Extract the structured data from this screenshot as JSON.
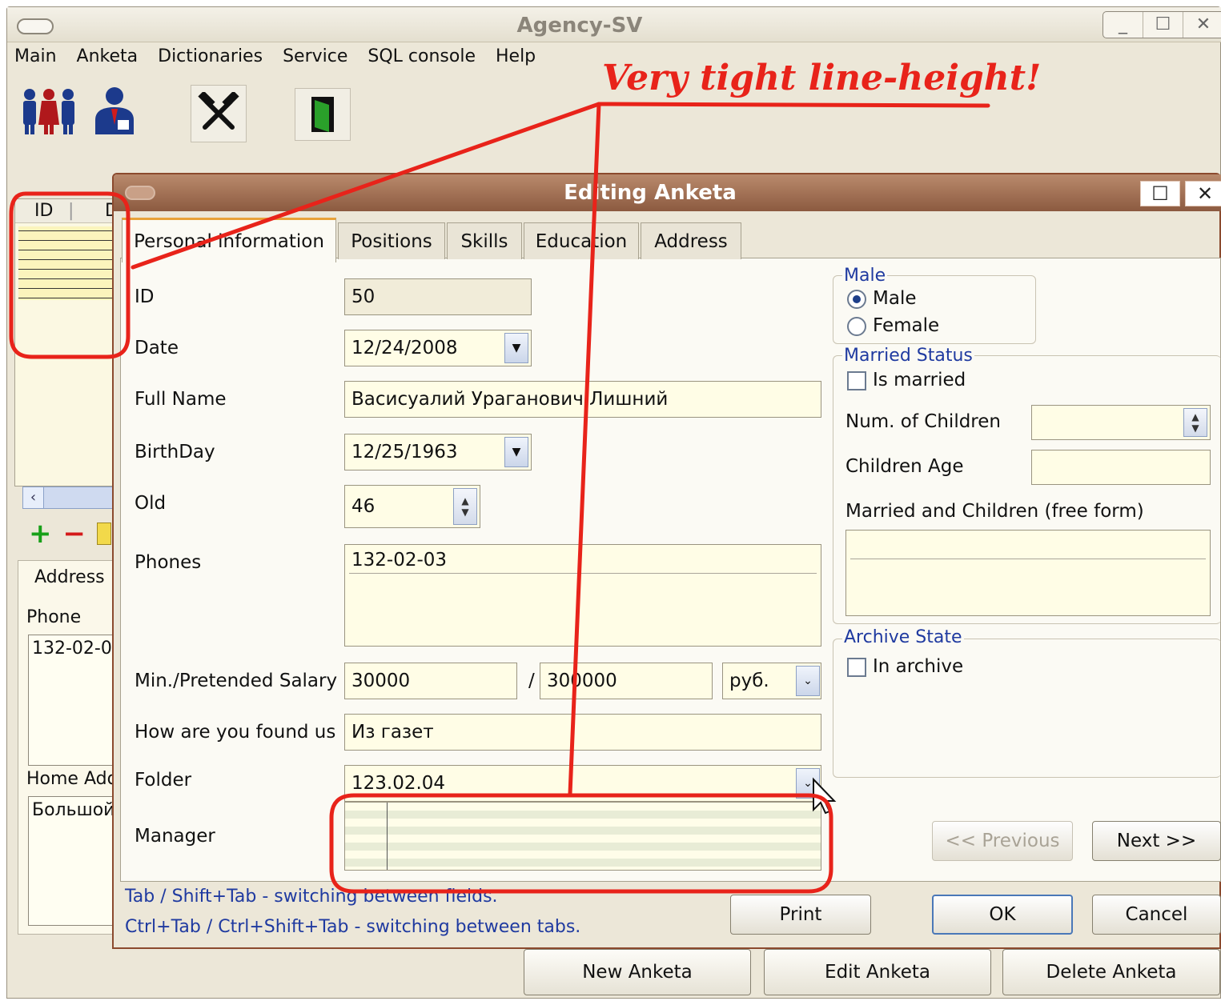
{
  "main_window": {
    "title": "Agency-SV",
    "menu": [
      "Main",
      "Anketa",
      "Dictionaries",
      "Service",
      "SQL console",
      "Help"
    ],
    "toolbar_icons": [
      "people-group-icon",
      "manager-person-icon",
      "hammer-tools-icon",
      "exit-door-icon"
    ]
  },
  "left_panel": {
    "column_id": "ID",
    "column_2": "D",
    "address_tab": "Address",
    "phone_label": "Phone",
    "phone_value": "132-02-0",
    "home_address_label": "Home Add",
    "home_address_value": "Большой"
  },
  "bottom_buttons": {
    "new": "New Anketa",
    "edit": "Edit Anketa",
    "delete": "Delete Anketa"
  },
  "dialog": {
    "title": "Editing Anketa",
    "tabs": [
      "Personal information",
      "Positions",
      "Skills",
      "Education",
      "Address"
    ],
    "fields": {
      "id_label": "ID",
      "id_value": "50",
      "date_label": "Date",
      "date_value": "12/24/2008",
      "fullname_label": "Full Name",
      "fullname_value": "Васисуалий Ураганович Лишний",
      "birthday_label": "BirthDay",
      "birthday_value": "12/25/1963",
      "old_label": "Old",
      "old_value": "46",
      "phones_label": "Phones",
      "phones_value": "132-02-03",
      "salary_label": "Min./Pretended Salary",
      "salary_min": "30000",
      "salary_sep": "/",
      "salary_max": "300000",
      "currency": "руб.",
      "found_label": "How are you found us",
      "found_value": "Из газет",
      "folder_label": "Folder",
      "folder_value": "123.02.04",
      "manager_label": "Manager"
    },
    "sex_group": {
      "title": "Male",
      "male": "Male",
      "female": "Female",
      "selected": "Male"
    },
    "married_group": {
      "title": "Married Status",
      "is_married": "Is married",
      "children_num": "Num. of Children",
      "children_age": "Children Age",
      "free_form": "Married and Children (free form)"
    },
    "archive_group": {
      "title": "Archive State",
      "in_archive": "In archive"
    },
    "nav": {
      "previous": "<< Previous",
      "next": "Next >>"
    },
    "hints": [
      "Tab / Shift+Tab - switching between fields.",
      "Ctrl+Tab / Ctrl+Shift+Tab - switching between tabs."
    ],
    "buttons": {
      "print": "Print",
      "ok": "OK",
      "cancel": "Cancel"
    }
  },
  "annotation": {
    "text": "Very tight line-height!",
    "color": "#e8231a"
  }
}
